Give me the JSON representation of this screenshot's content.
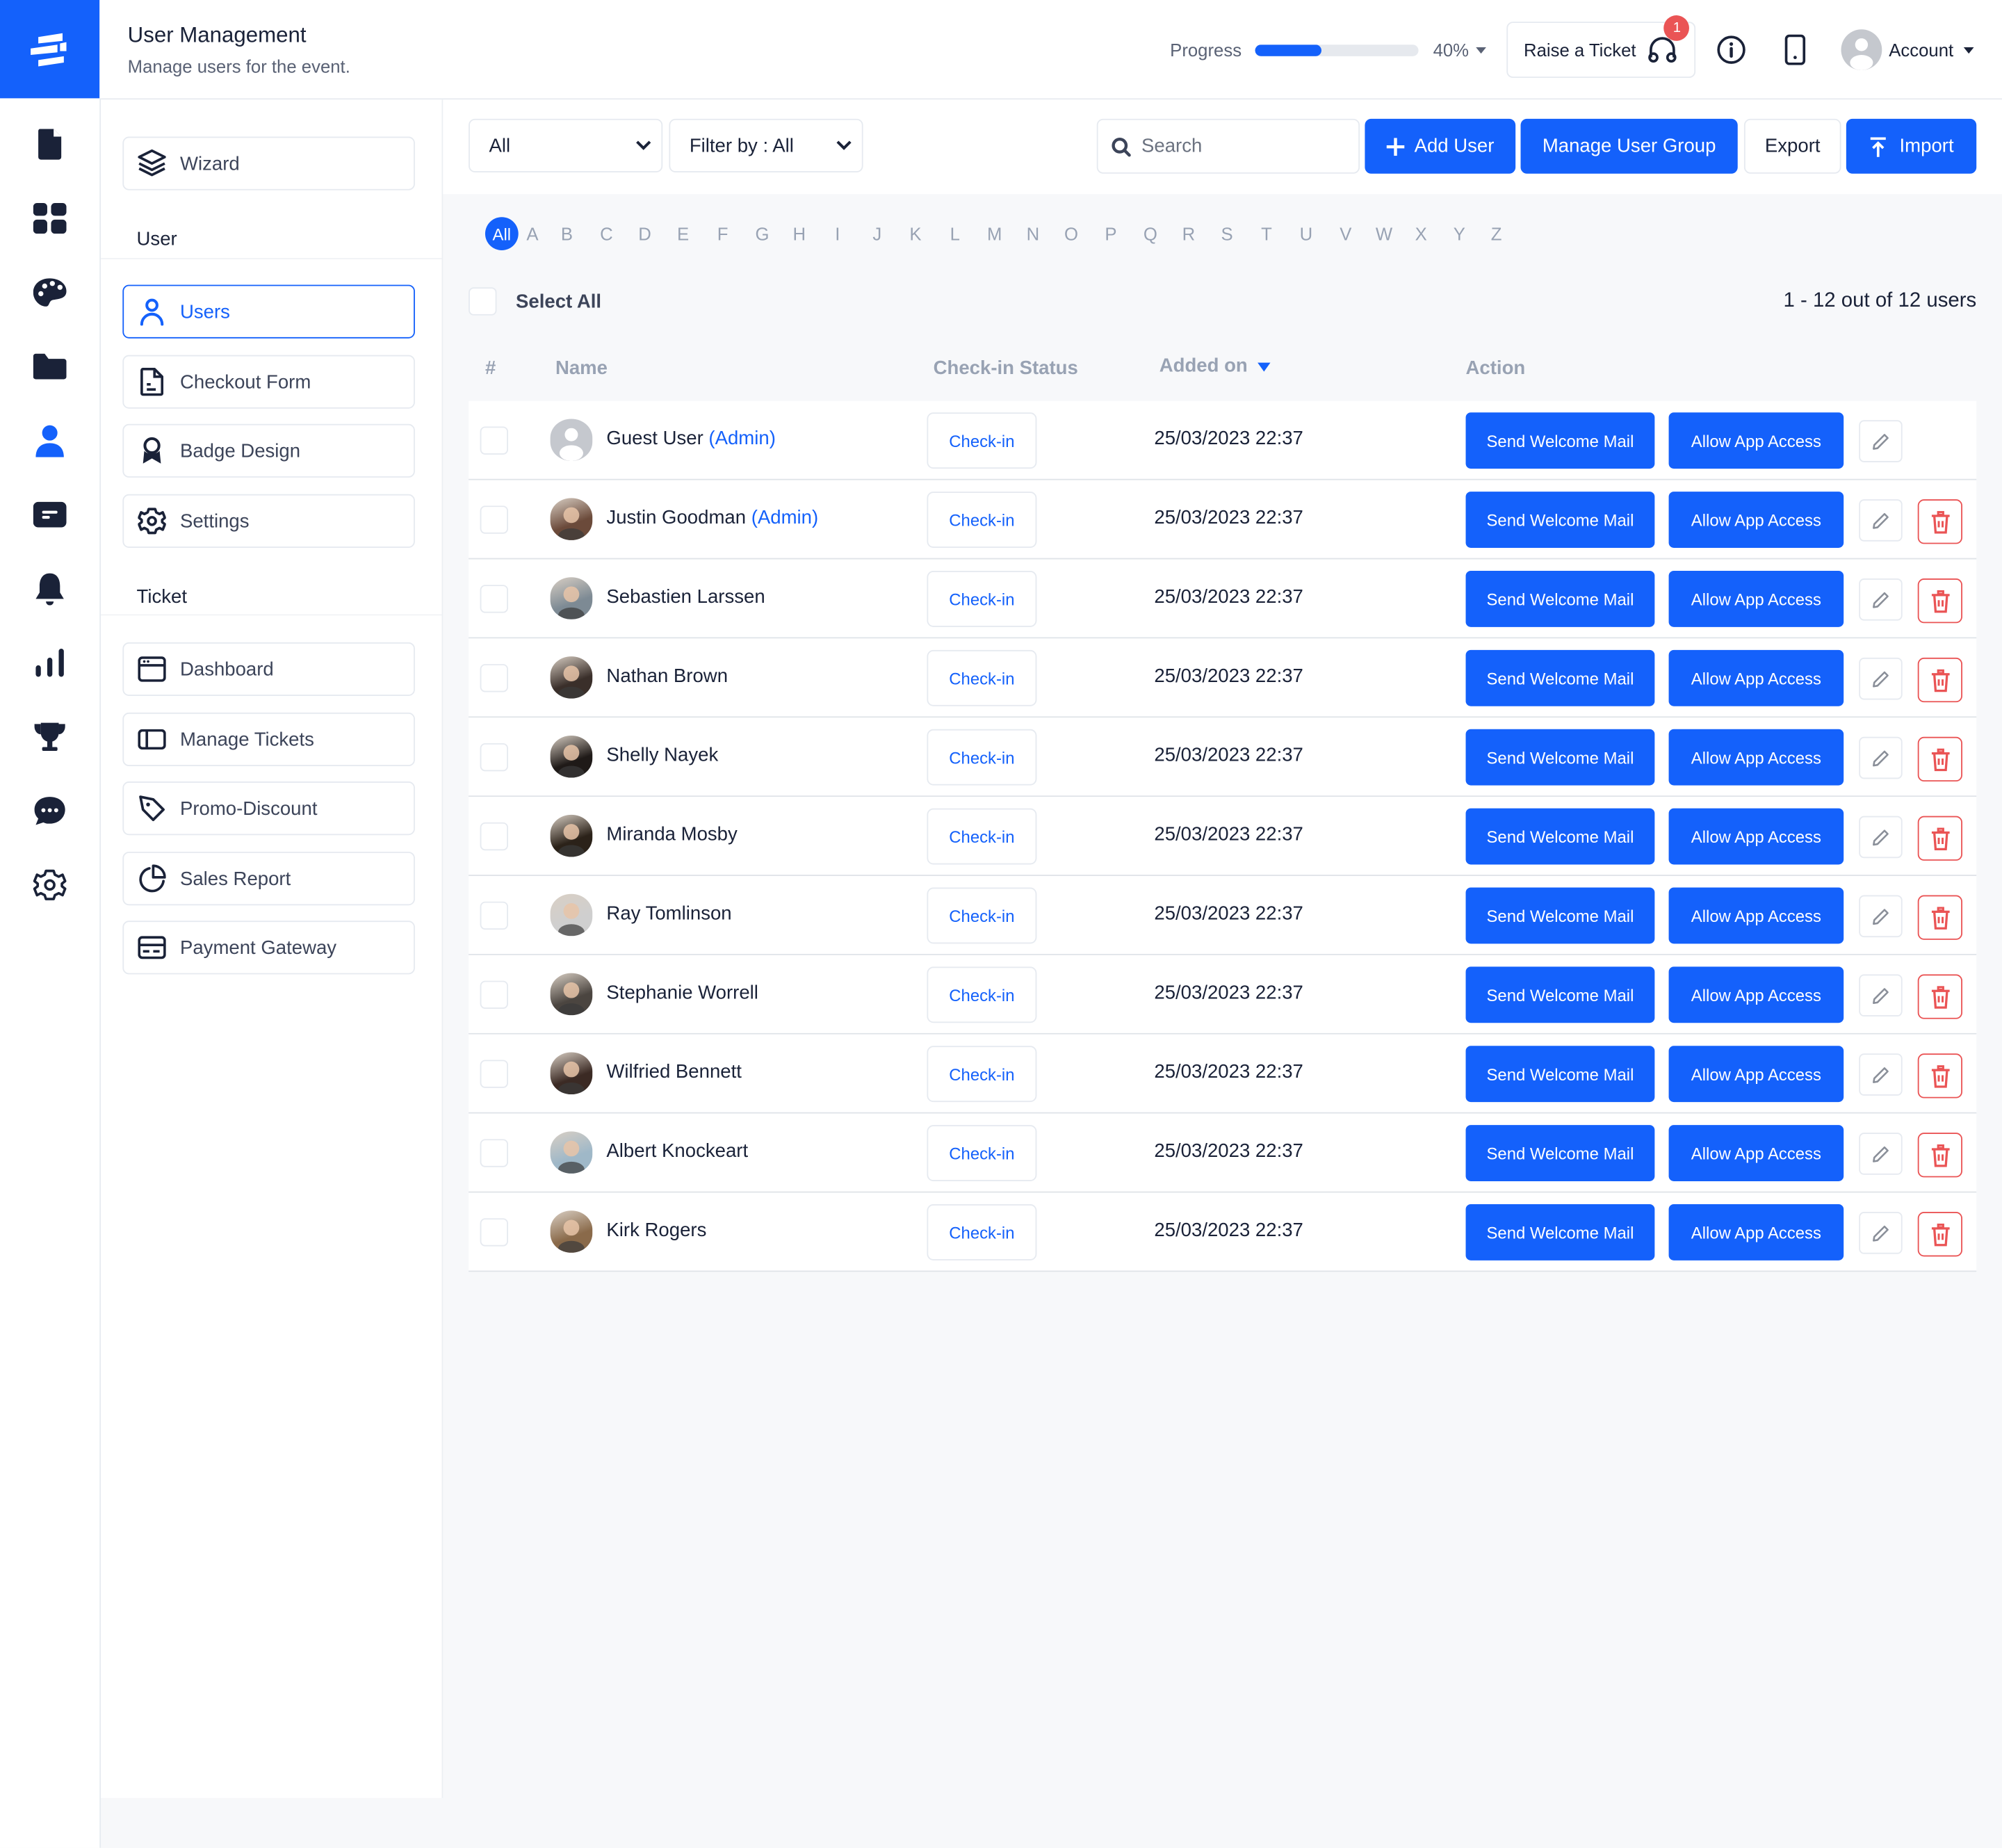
{
  "header": {
    "title": "User Management",
    "subtitle": "Manage users for the event.",
    "progress_label": "Progress",
    "progress_value": 0.4,
    "progress_text": "40%",
    "raise_ticket_label": "Raise a Ticket",
    "ticket_badge_count": "1",
    "account_label": "Account"
  },
  "rail": {
    "items": [
      {
        "icon": "document-icon"
      },
      {
        "icon": "grid-icon"
      },
      {
        "icon": "palette-icon"
      },
      {
        "icon": "folder-icon"
      },
      {
        "icon": "user-icon",
        "active": true
      },
      {
        "icon": "ticket-icon"
      },
      {
        "icon": "bell-icon"
      },
      {
        "icon": "bar-chart-icon"
      },
      {
        "icon": "trophy-icon"
      },
      {
        "icon": "chat-icon"
      },
      {
        "icon": "gear-icon"
      }
    ]
  },
  "subnav": {
    "wizard_label": "Wizard",
    "user_section": "User",
    "user_items": [
      {
        "label": "Users",
        "icon": "user-outline-icon",
        "active": true
      },
      {
        "label": "Checkout Form",
        "icon": "form-icon"
      },
      {
        "label": "Badge Design",
        "icon": "badge-icon"
      },
      {
        "label": "Settings",
        "icon": "settings-icon"
      }
    ],
    "ticket_section": "Ticket",
    "ticket_items": [
      {
        "label": "Dashboard",
        "icon": "dashboard-icon"
      },
      {
        "label": "Manage Tickets",
        "icon": "manage-tickets-icon"
      },
      {
        "label": "Promo-Discount",
        "icon": "tag-icon"
      },
      {
        "label": "Sales Report",
        "icon": "pie-chart-icon"
      },
      {
        "label": "Payment Gateway",
        "icon": "credit-card-icon"
      }
    ]
  },
  "toolbar": {
    "type_select": "All",
    "filter_select": "Filter by : All",
    "search_placeholder": "Search",
    "add_user": "Add User",
    "manage_group": "Manage User Group",
    "export": "Export",
    "import": "Import"
  },
  "alphabet": {
    "selected": "All",
    "letters": [
      "A",
      "B",
      "C",
      "D",
      "E",
      "F",
      "G",
      "H",
      "I",
      "J",
      "K",
      "L",
      "M",
      "N",
      "O",
      "P",
      "Q",
      "R",
      "S",
      "T",
      "U",
      "V",
      "W",
      "X",
      "Y",
      "Z"
    ]
  },
  "list": {
    "select_all": "Select All",
    "count_text": "1 - 12 out of 12 users",
    "columns": {
      "index": "#",
      "name": "Name",
      "checkin": "Check-in Status",
      "added": "Added on",
      "action": "Action"
    },
    "action_labels": {
      "welcome": "Send Welcome Mail",
      "app_access": "Allow App Access"
    },
    "rows": [
      {
        "name": "Guest User",
        "role": "(Admin)",
        "checkin": "Check-in",
        "added": "25/03/2023 22:37",
        "avatar": "default",
        "deletable": false
      },
      {
        "name": "Justin Goodman",
        "role": "(Admin)",
        "checkin": "Check-in",
        "added": "25/03/2023 22:37",
        "avatar": "photo",
        "deletable": true
      },
      {
        "name": "Sebastien Larssen",
        "role": "",
        "checkin": "Check-in",
        "added": "25/03/2023 22:37",
        "avatar": "photo",
        "deletable": true
      },
      {
        "name": "Nathan Brown",
        "role": "",
        "checkin": "Check-in",
        "added": "25/03/2023 22:37",
        "avatar": "photo",
        "deletable": true
      },
      {
        "name": "Shelly Nayek",
        "role": "",
        "checkin": "Check-in",
        "added": "25/03/2023 22:37",
        "avatar": "photo",
        "deletable": true
      },
      {
        "name": "Miranda Mosby",
        "role": "",
        "checkin": "Check-in",
        "added": "25/03/2023 22:37",
        "avatar": "photo",
        "deletable": true
      },
      {
        "name": "Ray Tomlinson",
        "role": "",
        "checkin": "Check-in",
        "added": "25/03/2023 22:37",
        "avatar": "photo",
        "deletable": true
      },
      {
        "name": "Stephanie Worrell",
        "role": "",
        "checkin": "Check-in",
        "added": "25/03/2023 22:37",
        "avatar": "photo",
        "deletable": true
      },
      {
        "name": "Wilfried Bennett",
        "role": "",
        "checkin": "Check-in",
        "added": "25/03/2023 22:37",
        "avatar": "photo",
        "deletable": true
      },
      {
        "name": "Albert Knockeart",
        "role": "",
        "checkin": "Check-in",
        "added": "25/03/2023 22:37",
        "avatar": "photo",
        "deletable": true
      },
      {
        "name": "Kirk Rogers",
        "role": "",
        "checkin": "Check-in",
        "added": "25/03/2023 22:37",
        "avatar": "photo",
        "deletable": true
      }
    ]
  },
  "colors": {
    "brand": "#1461fb",
    "danger": "#ea5455",
    "text": "#1a2238",
    "muted": "#98a2b3"
  }
}
